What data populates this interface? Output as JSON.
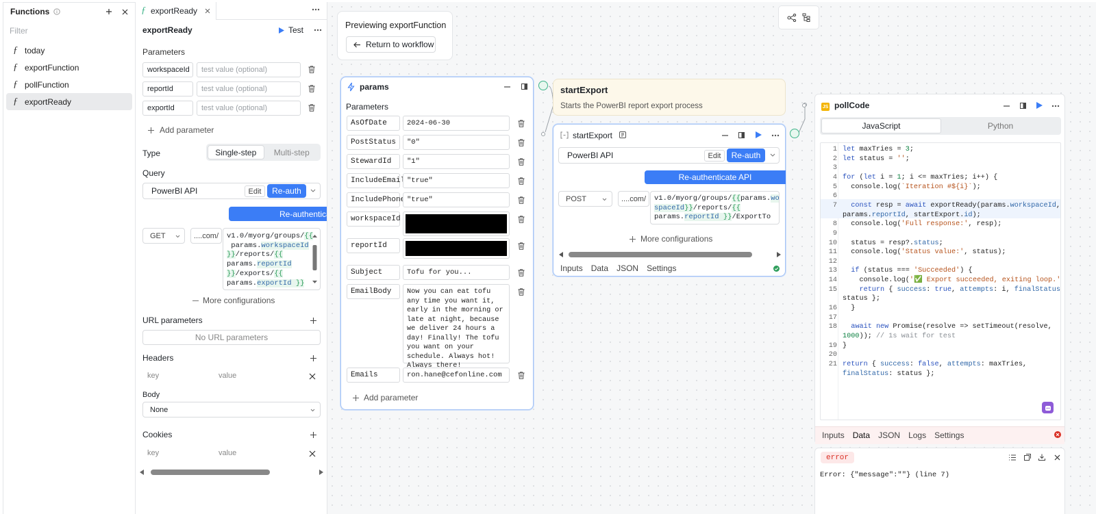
{
  "functions": {
    "title": "Functions",
    "filter_placeholder": "Filter",
    "items": [
      {
        "label": "today"
      },
      {
        "label": "exportFunction"
      },
      {
        "label": "pollFunction"
      },
      {
        "label": "exportReady"
      }
    ]
  },
  "editor": {
    "tab_label": "exportReady",
    "name": "exportReady",
    "test_label": "Test",
    "parameters_title": "Parameters",
    "params": [
      {
        "name": "workspaceId",
        "placeholder": "test value (optional)"
      },
      {
        "name": "reportId",
        "placeholder": "test value (optional)"
      },
      {
        "name": "exportId",
        "placeholder": "test value (optional)"
      }
    ],
    "add_parameter": "Add parameter",
    "type_label": "Type",
    "type_options": [
      "Single-step",
      "Multi-step"
    ],
    "query_label": "Query",
    "query_resource": "PowerBI API",
    "edit_label": "Edit",
    "reauth_label": "Re-auth",
    "reauth_banner": "Re-authenticate API",
    "method": "GET",
    "base_url": "....com/",
    "url_lines": [
      {
        "parts": [
          {
            "t": "v1.0/myorg/groups/",
            "c": "t"
          },
          {
            "t": "{{",
            "c": "b"
          }
        ]
      },
      {
        "parts": [
          {
            "t": " params.",
            "c": "t"
          },
          {
            "t": "workspaceId",
            "c": "v"
          }
        ]
      },
      {
        "parts": [
          {
            "t": "}}",
            "c": "b"
          },
          {
            "t": "/reports/",
            "c": "t"
          },
          {
            "t": "{{",
            "c": "b"
          }
        ]
      },
      {
        "parts": [
          {
            "t": "params.",
            "c": "t"
          },
          {
            "t": "reportId",
            "c": "v"
          }
        ]
      },
      {
        "parts": [
          {
            "t": "}}",
            "c": "b"
          },
          {
            "t": "/exports/",
            "c": "t"
          },
          {
            "t": "{{",
            "c": "b"
          }
        ]
      },
      {
        "parts": [
          {
            "t": "params.",
            "c": "t"
          },
          {
            "t": "exportId",
            "c": "v"
          },
          {
            "t": " }}",
            "c": "b"
          }
        ]
      }
    ],
    "more_config": "More configurations",
    "url_params_title": "URL parameters",
    "no_url_params": "No URL parameters",
    "headers_title": "Headers",
    "key_placeholder": "key",
    "value_placeholder": "value",
    "body_title": "Body",
    "body_value": "None",
    "cookies_title": "Cookies"
  },
  "preview": {
    "title": "Previewing exportFunction",
    "return_label": "Return to workflow"
  },
  "params_node": {
    "title": "params",
    "section": "Parameters",
    "rows": [
      {
        "name": "AsOfDate",
        "value": "2024-06-30"
      },
      {
        "name": "PostStatus",
        "value": "\"0\""
      },
      {
        "name": "StewardId",
        "value": "\"1\""
      },
      {
        "name": "IncludeEmail",
        "value": "\"true\""
      },
      {
        "name": "IncludePhone",
        "value": "\"true\""
      },
      {
        "name": "workspaceId",
        "value": ""
      },
      {
        "name": "reportId",
        "value": ""
      },
      {
        "name": "Subject",
        "value": "Tofu for you..."
      },
      {
        "name": "EmailBody",
        "value": "Now you can eat tofu any time you want it, early in the morning or late at night, because we deliver 24 hours a day! Finally! The tofu you want on your schedule. Always hot! Always there!"
      },
      {
        "name": "Emails",
        "value": "ron.hane@cefonline.com"
      }
    ],
    "add_parameter": "Add parameter"
  },
  "start_export_note": {
    "title": "startExport",
    "subtitle": "Starts the PowerBI report export process"
  },
  "start_export_node": {
    "title": "startExport",
    "resource": "PowerBI API",
    "edit_label": "Edit",
    "reauth_label": "Re-auth",
    "reauth_banner": "Re-authenticate API",
    "method": "POST",
    "base_url": "....com/",
    "url_lines": [
      {
        "parts": [
          {
            "t": "v1.0/myorg/groups/",
            "c": "t"
          },
          {
            "t": "{{",
            "c": "b"
          },
          {
            "t": "params.",
            "c": "t"
          },
          {
            "t": "work",
            "c": "v"
          }
        ]
      },
      {
        "parts": [
          {
            "t": "spaceId",
            "c": "v"
          },
          {
            "t": "}}",
            "c": "b"
          },
          {
            "t": "/reports/",
            "c": "t"
          },
          {
            "t": "{{",
            "c": "b"
          }
        ]
      },
      {
        "parts": [
          {
            "t": "params.",
            "c": "t"
          },
          {
            "t": "reportId",
            "c": "v"
          },
          {
            "t": " }}",
            "c": "b"
          },
          {
            "t": "/ExportTo",
            "c": "t"
          }
        ]
      }
    ],
    "more_config": "More configurations",
    "tabs": [
      "Inputs",
      "Data",
      "JSON",
      "Settings"
    ]
  },
  "poll_node": {
    "title": "pollCode",
    "lang_tabs": [
      "JavaScript",
      "Python"
    ],
    "code_lines": [
      {
        "n": "1",
        "html": "<span class='kw'>let</span> maxTries = <span class='nm'>3</span>;"
      },
      {
        "n": "2",
        "html": "<span class='kw'>let</span> status = <span class='st'>''</span>;"
      },
      {
        "n": "3",
        "html": ""
      },
      {
        "n": "4",
        "html": "<span class='kw'>for</span> (<span class='kw'>let</span> i = <span class='nm'>1</span>; i &lt;= maxTries; i++) {"
      },
      {
        "n": "5",
        "html": "  console.log(<span class='st'>`Iteration #${i}`</span>);"
      },
      {
        "n": "6",
        "html": ""
      },
      {
        "n": "7",
        "html": "  <span class='kw'>const</span> resp = <span class='kw'>await</span> exportReady(params.<span class='pr'>workspaceId</span>,"
      },
      {
        "n": "",
        "html": "params.<span class='pr'>reportId</span>, startExport.<span class='pr'>id</span>);"
      },
      {
        "n": "8",
        "html": "  console.log(<span class='st'>'Full response:'</span>, resp);"
      },
      {
        "n": "9",
        "html": ""
      },
      {
        "n": "10",
        "html": "  status = resp?.<span class='pr'>status</span>;"
      },
      {
        "n": "11",
        "html": "  console.log(<span class='st'>'Status value:'</span>, status);"
      },
      {
        "n": "12",
        "html": ""
      },
      {
        "n": "13",
        "html": "  <span class='kw'>if</span> (status === <span class='st'>'Succeeded'</span>) {"
      },
      {
        "n": "14",
        "html": "    console.log(<span class='st'>'<span class=\"ok\">✅</span> Export succeeded, exiting loop.'</span>);"
      },
      {
        "n": "15",
        "html": "    <span class='kw'>return</span> { <span class='pr'>success</span>: <span class='kw'>true</span>, <span class='pr'>attempts</span>: i, <span class='pr'>finalStatus</span>:"
      },
      {
        "n": "",
        "html": "status };"
      },
      {
        "n": "16",
        "html": "  }"
      },
      {
        "n": "17",
        "html": ""
      },
      {
        "n": "18",
        "html": "  <span class='kw'>await</span> <span class='kw'>new</span> Promise(resolve =&gt; setTimeout(resolve,"
      },
      {
        "n": "",
        "html": "<span class='nm'>1000</span>)); <span class='cm'>// 1s wait for test</span>"
      },
      {
        "n": "19",
        "html": "}"
      },
      {
        "n": "20",
        "html": ""
      },
      {
        "n": "21",
        "html": "<span class='kw'>return</span> { <span class='pr'>success</span>: <span class='kw'>false</span>, <span class='pr'>attempts</span>: maxTries,"
      },
      {
        "n": "",
        "html": "<span class='pr'>finalStatus</span>: status };"
      }
    ],
    "tabs": [
      "Inputs",
      "Data",
      "JSON",
      "Logs",
      "Settings"
    ],
    "error_badge": "error",
    "error_text": "Error: {\"message\":\"\"} (line 7)"
  },
  "colors": {
    "accent": "#3b7df6",
    "handle": "#3eb489",
    "error": "#d93025"
  }
}
